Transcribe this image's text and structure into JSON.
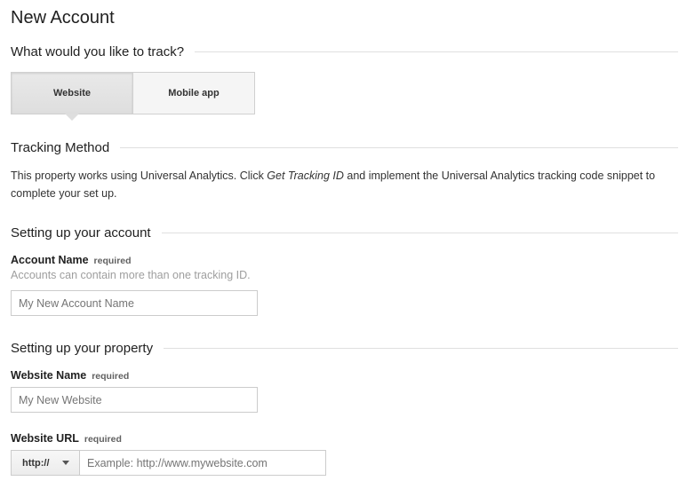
{
  "page": {
    "title": "New Account"
  },
  "track": {
    "heading": "What would you like to track?",
    "options": [
      {
        "label": "Website",
        "selected": true
      },
      {
        "label": "Mobile app",
        "selected": false
      }
    ]
  },
  "tracking_method": {
    "heading": "Tracking Method",
    "text_before": "This property works using Universal Analytics. Click ",
    "text_emphasis": "Get Tracking ID",
    "text_after": " and implement the Universal Analytics tracking code snippet to complete your set up."
  },
  "account": {
    "heading": "Setting up your account",
    "name_label": "Account Name",
    "required": "required",
    "helper": "Accounts can contain more than one tracking ID.",
    "name_placeholder": "My New Account Name"
  },
  "property": {
    "heading": "Setting up your property",
    "website_name_label": "Website Name",
    "required": "required",
    "website_name_placeholder": "My New Website",
    "website_url_label": "Website URL",
    "protocol": "http://",
    "url_placeholder": "Example: http://www.mywebsite.com"
  }
}
